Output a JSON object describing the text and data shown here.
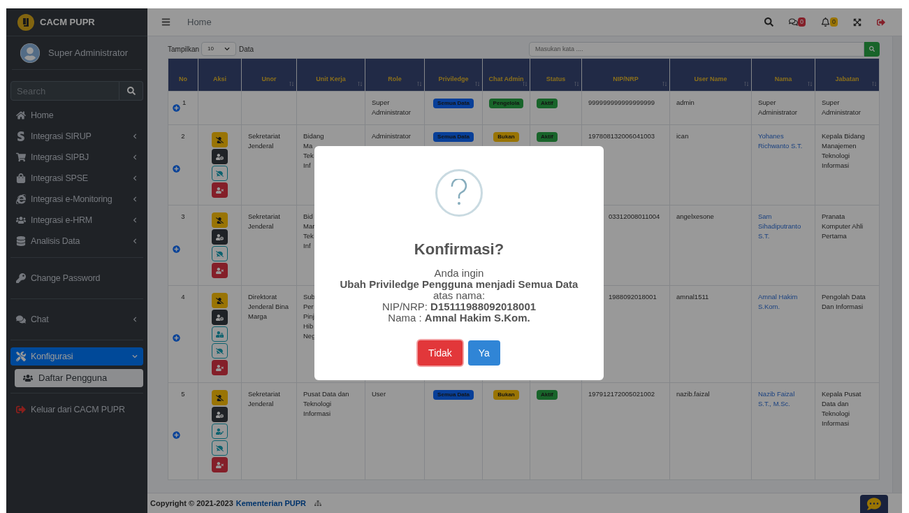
{
  "brand": {
    "name": "CACM PUPR"
  },
  "user": {
    "name": "Super Administrator"
  },
  "sidebar": {
    "search": {
      "placeholder": "Search"
    },
    "sections": [
      {
        "items": [
          {
            "label": "Home",
            "submenu": false,
            "expanded": false,
            "selected": false
          },
          {
            "label": "Integrasi SIRUP",
            "submenu": true,
            "expanded": false,
            "selected": false
          },
          {
            "label": "Integrasi SIPBJ",
            "submenu": true,
            "expanded": false,
            "selected": false
          },
          {
            "label": "Integrasi SPSE",
            "submenu": true,
            "expanded": false,
            "selected": false
          },
          {
            "label": "Integrasi e-Monitoring",
            "submenu": true,
            "expanded": false,
            "selected": false
          },
          {
            "label": "Integrasi e-HRM",
            "submenu": true,
            "expanded": false,
            "selected": false
          },
          {
            "label": "Analisis Data",
            "submenu": true,
            "expanded": false,
            "selected": false
          }
        ]
      },
      {
        "items": [
          {
            "label": "Change Password",
            "submenu": false,
            "expanded": false,
            "selected": false
          }
        ]
      },
      {
        "items": [
          {
            "label": "Chat",
            "submenu": true,
            "expanded": false,
            "selected": false
          }
        ]
      },
      {
        "items": [
          {
            "label": "Konfigurasi",
            "submenu": true,
            "expanded": true,
            "selected": true,
            "children": [
              {
                "label": "Daftar Pengguna",
                "selected": true
              }
            ]
          }
        ]
      },
      {
        "items": [
          {
            "label": "Keluar dari CACM PUPR",
            "submenu": false,
            "expanded": false,
            "selected": false
          }
        ]
      }
    ]
  },
  "header": {
    "breadcrumb": "Home",
    "messages_count": "0",
    "alerts_count": "0"
  },
  "toolbar": {
    "show_label": "Tampilkan",
    "page_size": "10",
    "data_label": "Data",
    "search": {
      "placeholder": "Masukan kata ...."
    }
  },
  "table": {
    "columns": [
      {
        "label": "No",
        "sortable": false
      },
      {
        "label": "Aksi",
        "sortable": false
      },
      {
        "label": "Unor",
        "sortable": true
      },
      {
        "label": "Unit Kerja",
        "sortable": true
      },
      {
        "label": "Role",
        "sortable": true
      },
      {
        "label": "Priviledge",
        "sortable": true
      },
      {
        "label": "Chat Admin",
        "sortable": true
      },
      {
        "label": "Status",
        "sortable": true
      },
      {
        "label": "NIP/NRP",
        "sortable": true
      },
      {
        "label": "User Name",
        "sortable": true
      },
      {
        "label": "Nama",
        "sortable": true
      },
      {
        "label": "Jabatan",
        "sortable": true
      }
    ],
    "rows": [
      {
        "no": "1",
        "actions": [],
        "role": "Super Administrator",
        "privilege": {
          "text": "Semua Data",
          "color": "#083f98"
        },
        "chat_admin": {
          "text": "Pengelola",
          "color": "#18642a"
        },
        "status": {
          "text": "Aktif",
          "color": "#18642a"
        },
        "nip": "999999999999999999",
        "username": "admin",
        "nama": {
          "text": "Super Administrator",
          "link": false
        },
        "jabatan": "Super Administrator"
      },
      {
        "no": "2",
        "actions": [
          {
            "kind": "deactivate"
          },
          {
            "kind": "settings"
          },
          {
            "kind": "chat_off"
          },
          {
            "kind": "delete"
          }
        ],
        "unor": "Sekretariat Jenderal",
        "unit_kerja": "Bidang\nMa\nTek\nInf",
        "role": "Administrator",
        "privilege": {
          "text": "Semua Data",
          "color": "#083f98"
        },
        "chat_admin": {
          "text": "Bukan",
          "color": "#997404"
        },
        "status": {
          "text": "Aktif",
          "color": "#18642a"
        },
        "nip": "197808132006041003",
        "username": "ican",
        "nama": {
          "text": "Yohanes Richwanto S.T.",
          "link": true
        },
        "jabatan": "Kepala Bidang Manajemen Teknologi Informasi"
      },
      {
        "no": "3",
        "actions": [
          {
            "kind": "deactivate"
          },
          {
            "kind": "settings"
          },
          {
            "kind": "chat_off"
          },
          {
            "kind": "delete"
          }
        ],
        "unor": "Sekretariat Jenderal",
        "unit_kerja": "Bid\nMar\nTek\nInf",
        "nip": "03312008011004",
        "username": "angelxesone",
        "nama": {
          "text": "Sam Sihadiputranto S.T.",
          "link": true
        },
        "jabatan": "Pranata Komputer Ahli Pertama"
      },
      {
        "no": "4",
        "actions": [
          {
            "kind": "deactivate"
          },
          {
            "kind": "settings"
          },
          {
            "kind": "lock"
          },
          {
            "kind": "chat_off"
          },
          {
            "kind": "delete"
          }
        ],
        "unor": "Direktorat Jenderal Bina Marga",
        "unit_kerja": "Sub\nPer\nPinj\nHib\nNeg",
        "nip": "1988092018001",
        "username": "amnal1511",
        "nama": {
          "text": "Amnal Hakim S.Kom.",
          "link": true
        },
        "jabatan": "Pengolah Data Dan Informasi"
      },
      {
        "no": "5",
        "actions": [
          {
            "kind": "deactivate"
          },
          {
            "kind": "settings"
          },
          {
            "kind": "edit"
          },
          {
            "kind": "chat_off"
          },
          {
            "kind": "delete"
          }
        ],
        "unor": "Sekretariat Jenderal",
        "unit_kerja": "Pusat Data dan Teknologi Informasi",
        "role": "User",
        "privilege": {
          "text": "Semua Data",
          "color": "#083f98"
        },
        "chat_admin": {
          "text": "Bukan",
          "color": "#997404"
        },
        "status": {
          "text": "Aktif",
          "color": "#18642a"
        },
        "nip": "197912172005021002",
        "username": "nazib.faizal",
        "nama": {
          "text": "Nazib Faizal S.T., M.Sc.",
          "link": true
        },
        "jabatan": "Kepala Pusat Data dan Teknologi Informasi"
      }
    ]
  },
  "footer": {
    "text": "Copyright © 2021-2023",
    "link": "Kementerian PUPR"
  },
  "dialog": {
    "title": "Konfirmasi?",
    "lines": [
      "Anda ingin",
      "**Ubah Priviledge Pengguna menjadi Semua Data**",
      "atas nama:",
      "NIP/NRP: **D15111988092018001**",
      "Nama : **Amnal Hakim S.Kom.**"
    ],
    "buttons": [
      {
        "label": "Tidak",
        "kind": "cancel"
      },
      {
        "label": "Ya",
        "kind": "confirm"
      }
    ]
  }
}
